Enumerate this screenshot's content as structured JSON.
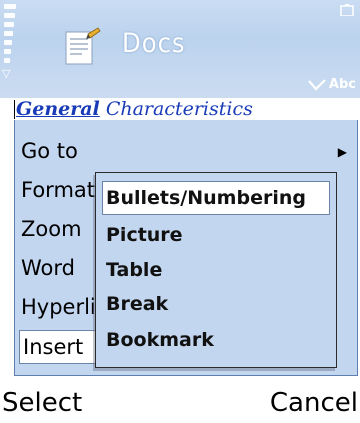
{
  "header": {
    "app_title": "Docs",
    "input_mode": "Abc"
  },
  "document": {
    "line_underlined": "General",
    "line_rest": "Characteristics"
  },
  "menu": {
    "items": [
      {
        "label": "Go to",
        "has_submenu": true
      },
      {
        "label": "Format"
      },
      {
        "label": "Zoom"
      },
      {
        "label": "Word"
      },
      {
        "label": "Hyperlink"
      },
      {
        "label": "Insert",
        "selected": true
      }
    ]
  },
  "submenu": {
    "items": [
      {
        "label": "Bullets/Numbering",
        "selected": true
      },
      {
        "label": "Picture"
      },
      {
        "label": "Table"
      },
      {
        "label": "Break"
      },
      {
        "label": "Bookmark"
      }
    ]
  },
  "softkeys": {
    "left": "Select",
    "right": "Cancel"
  },
  "icons": {
    "signal": "signal-strength-icon",
    "antenna": "antenna-icon",
    "app": "docs-app-icon",
    "battery": "battery-icon",
    "input": "pen-input-icon",
    "submenu_arrow": "triangle-right-icon"
  },
  "colors": {
    "header_bg": "#c3d6ef",
    "menu_bg": "#c3d6ef",
    "highlight_bg": "#ffffff",
    "doc_text": "#1a3bb8"
  }
}
